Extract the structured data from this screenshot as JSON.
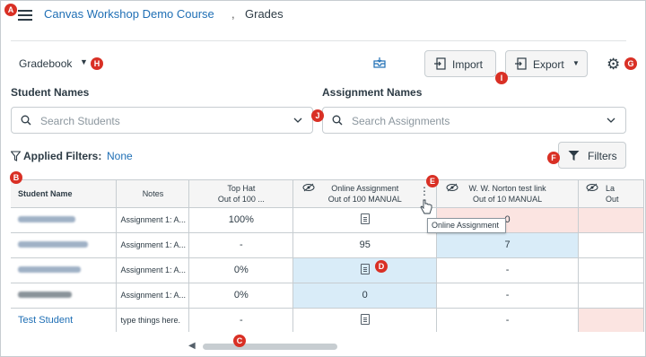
{
  "breadcrumb": {
    "course": "Canvas Workshop Demo Course",
    "separator": ",",
    "page": "Grades"
  },
  "toolbar": {
    "gradebook_label": "Gradebook",
    "import_label": "Import",
    "export_label": "Export"
  },
  "student_search": {
    "label": "Student Names",
    "placeholder": "Search Students"
  },
  "assignment_search": {
    "label": "Assignment Names",
    "placeholder": "Search Assignments"
  },
  "filters": {
    "applied_label": "Applied Filters:",
    "applied_value": "None",
    "button_label": "Filters"
  },
  "table": {
    "headers": {
      "student": "Student Name",
      "notes": "Notes",
      "tophat_title": "Top Hat",
      "tophat_sub": "Out of 100 ...",
      "online_title": "Online Assignment",
      "online_sub": "Out of 100 MANUAL",
      "norton_title": "W. W. Norton test link",
      "norton_sub": "Out of 10 MANUAL",
      "partial_title": "La",
      "partial_sub": "Out"
    },
    "rows": [
      {
        "notes": "Assignment 1: A...",
        "tophat": "100%",
        "online": "",
        "norton": "0"
      },
      {
        "notes": "Assignment 1: A...",
        "tophat": "-",
        "online": "95",
        "norton": "7"
      },
      {
        "notes": "Assignment 1: A...",
        "tophat": "0%",
        "online": "",
        "norton": "-"
      },
      {
        "notes": "Assignment 1: A...",
        "tophat": "0%",
        "online": "0",
        "norton": "-"
      },
      {
        "student": "Test Student",
        "notes": "type things here.",
        "tophat": "-",
        "online": "",
        "norton": "-"
      }
    ]
  },
  "tooltip": "Online Assignment",
  "markers": [
    "A",
    "B",
    "C",
    "D",
    "E",
    "F",
    "G",
    "H",
    "I",
    "J"
  ],
  "colors": {
    "link": "#1f6fb5",
    "marker": "#d93025",
    "selected_cell": "#d9ecf8",
    "flagged_cell": "#fbe4e1"
  }
}
